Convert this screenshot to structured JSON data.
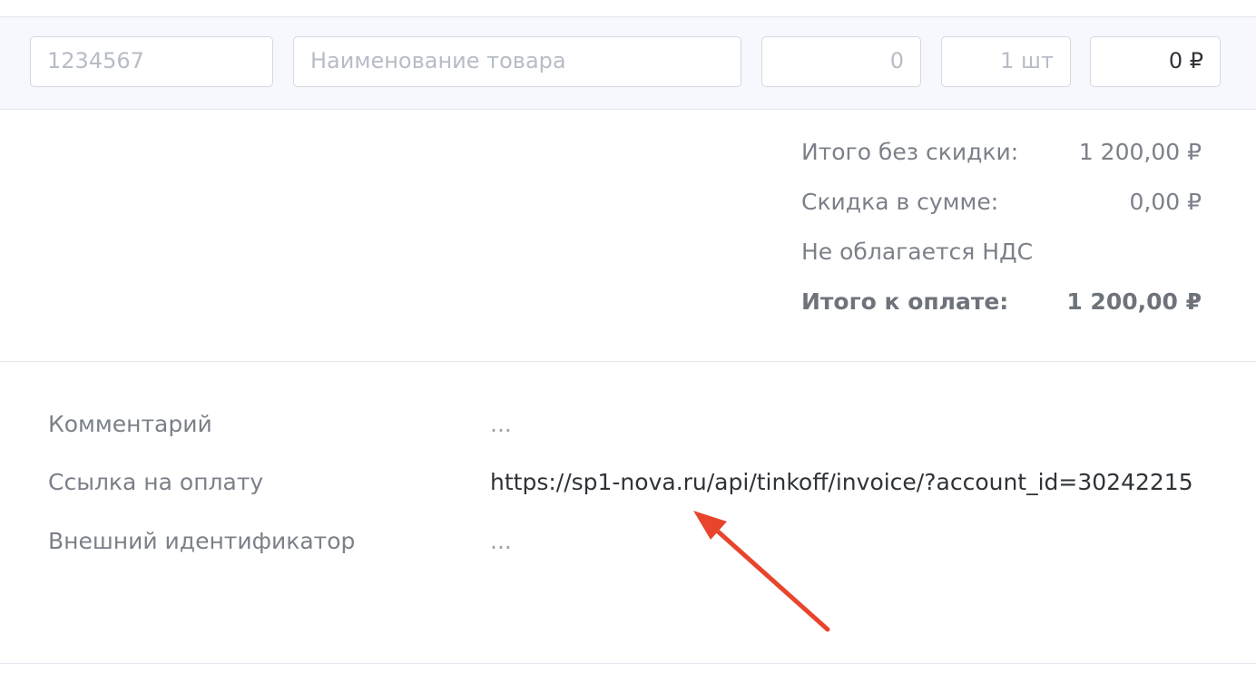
{
  "product_row": {
    "article_placeholder": "1234567",
    "name_placeholder": "Наименование товара",
    "discount_value": "0",
    "quantity_value": "1 шт",
    "sum_value": "0 ₽"
  },
  "totals": {
    "subtotal_label": "Итого без скидки:",
    "subtotal_value": "1 200,00 ₽",
    "discount_label": "Скидка в сумме:",
    "discount_value": "0,00 ₽",
    "vat_label": "Не облагается НДС",
    "total_label": "Итого к оплате:",
    "total_value": "1 200,00 ₽"
  },
  "details": {
    "comment_label": "Комментарий",
    "comment_value": "...",
    "payment_link_label": "Ссылка на оплату",
    "payment_link_value": "https://sp1-nova.ru/api/tinkoff/invoice/?account_id=30242215",
    "external_id_label": "Внешний идентификатор",
    "external_id_value": "..."
  },
  "annotation": {
    "arrow_color": "#e8452c"
  }
}
